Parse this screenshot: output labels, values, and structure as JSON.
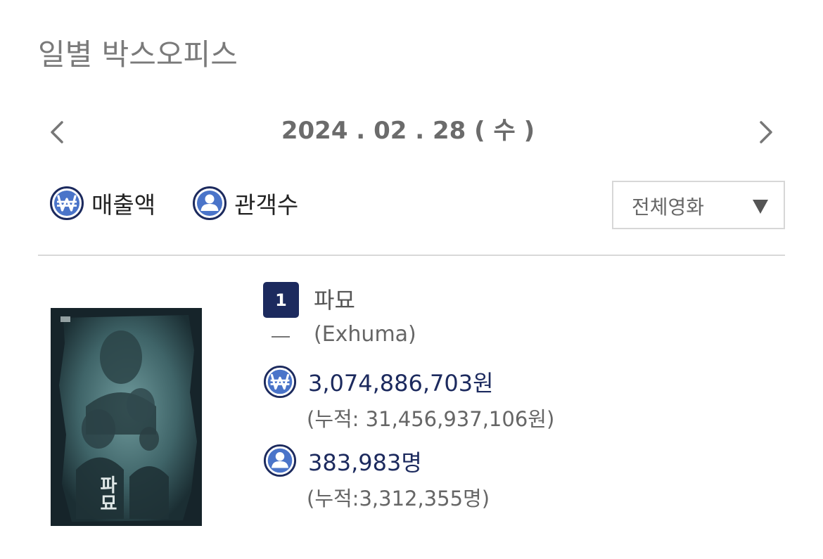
{
  "header": {
    "title": "일별 박스오피스"
  },
  "date_nav": {
    "date": "2024 . 02 . 28 ( 수 )",
    "prev_icon": "chevron-left-icon",
    "next_icon": "chevron-right-icon"
  },
  "mode_toggle": {
    "sales_label": "매출액",
    "audience_label": "관객수",
    "sales_icon": "won-icon",
    "audience_icon": "person-icon"
  },
  "filter": {
    "selected": "전체영화"
  },
  "colors": {
    "navy": "#1c2a5e",
    "icon_blue": "#4a74c9",
    "title_gray": "#7a7a7a"
  },
  "movies": [
    {
      "rank": "1",
      "rank_change": "–",
      "title": "파묘",
      "original_title": "(Exhuma)",
      "sales": "3,074,886,703원",
      "sales_cumulative": "(누적: 31,456,937,106원)",
      "audience": "383,983명",
      "audience_cumulative": "(누적:3,312,355명)",
      "poster_title": "파묘"
    }
  ]
}
